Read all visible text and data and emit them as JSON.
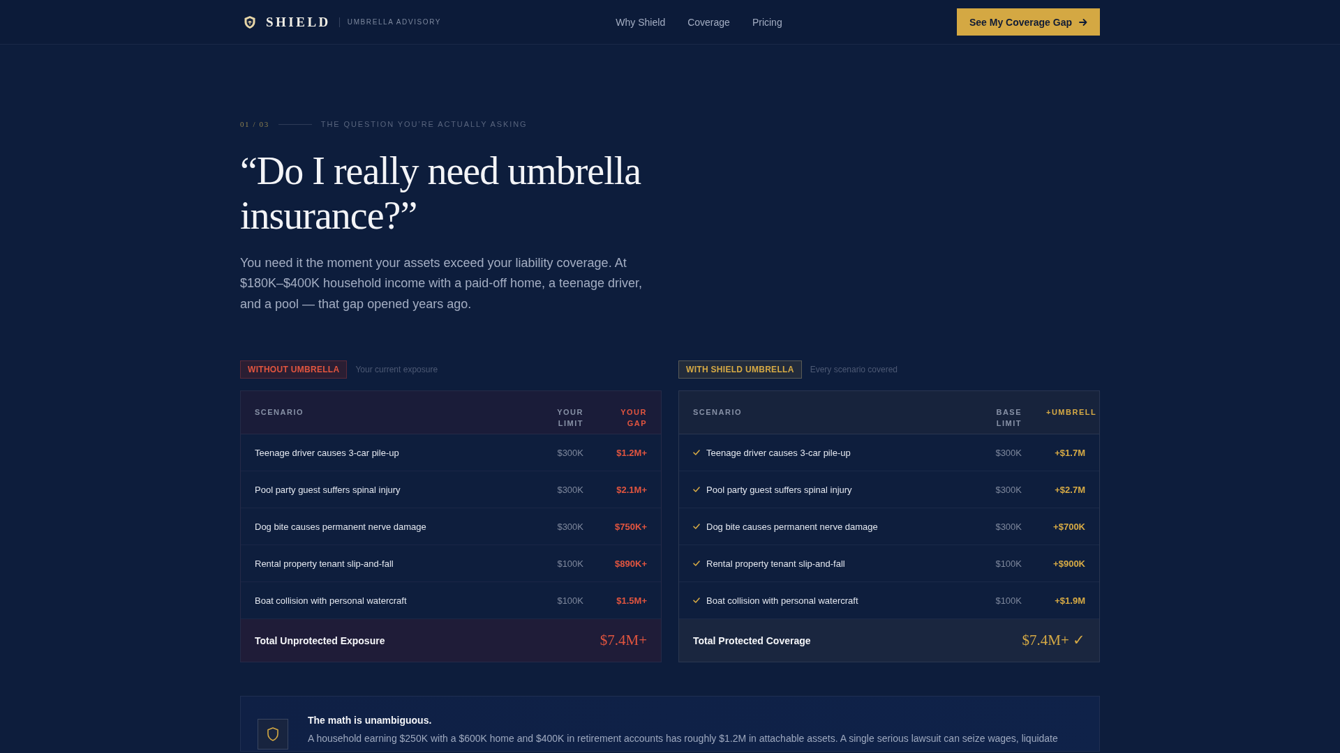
{
  "header": {
    "brand": "SHIELD",
    "tagline": "UMBRELLA ADVISORY",
    "nav": [
      {
        "label": "Why Shield"
      },
      {
        "label": "Coverage"
      },
      {
        "label": "Pricing"
      }
    ],
    "cta": "See My Coverage Gap"
  },
  "hero": {
    "step": "01 / 03",
    "eyebrow": "THE QUESTION YOU’RE ACTUALLY ASKING",
    "title": "“Do I really need umbrella insurance?”",
    "lead": "You need it the moment your assets exceed your liability coverage. At $180K–$400K household income with a paid-off home, a teenage driver, and a pool — that gap opened years ago."
  },
  "comparisons": [
    {
      "kind": "without",
      "label": "WITHOUT UMBRELLA",
      "note": "Your current exposure",
      "columns": [
        "SCENARIO",
        "YOUR LIMIT",
        "YOUR GAP"
      ],
      "rows": [
        {
          "scenario": "Teenage driver causes 3-car pile-up",
          "limit": "$300K",
          "amount": "$1.2M+"
        },
        {
          "scenario": "Pool party guest suffers spinal injury",
          "limit": "$300K",
          "amount": "$2.1M+"
        },
        {
          "scenario": "Dog bite causes permanent nerve damage",
          "limit": "$300K",
          "amount": "$750K+"
        },
        {
          "scenario": "Rental property tenant slip-and-fall",
          "limit": "$100K",
          "amount": "$890K+"
        },
        {
          "scenario": "Boat collision with personal watercraft",
          "limit": "$100K",
          "amount": "$1.5M+"
        }
      ],
      "total": {
        "label": "Total Unprotected Exposure",
        "value": "$7.4M+"
      }
    },
    {
      "kind": "with",
      "label": "WITH SHIELD UMBRELLA",
      "note": "Every scenario covered",
      "columns": [
        "SCENARIO",
        "BASE LIMIT",
        "+UMBRELL"
      ],
      "rows": [
        {
          "scenario": "Teenage driver causes 3-car pile-up",
          "limit": "$300K",
          "amount": "+$1.7M"
        },
        {
          "scenario": "Pool party guest suffers spinal injury",
          "limit": "$300K",
          "amount": "+$2.7M"
        },
        {
          "scenario": "Dog bite causes permanent nerve damage",
          "limit": "$300K",
          "amount": "+$700K"
        },
        {
          "scenario": "Rental property tenant slip-and-fall",
          "limit": "$100K",
          "amount": "+$900K"
        },
        {
          "scenario": "Boat collision with personal watercraft",
          "limit": "$100K",
          "amount": "+$1.9M"
        }
      ],
      "total": {
        "label": "Total Protected Coverage",
        "value": "$7.4M+ ✓"
      }
    }
  ],
  "callout": {
    "title": "The math is unambiguous.",
    "text": "A household earning $250K with a $600K home and $400K in retirement accounts has roughly $1.2M in attachable assets. A single serious lawsuit can seize wages, liquidate"
  }
}
